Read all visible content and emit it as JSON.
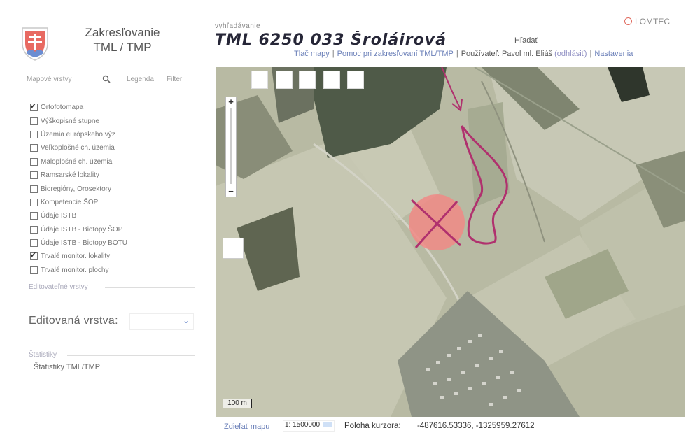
{
  "header": {
    "title_line1": "Zakresľovanie",
    "title_line2": "TML / TMP",
    "brand": "LOMTEC",
    "search_label": "vyhľadávanie",
    "search_value": "TML 6250 033 Šroláirová",
    "search_button": "Hľadať"
  },
  "toplinks": {
    "print": "Tlač mapy",
    "help": "Pomoc pri zakresľovaní TML/TMP",
    "user_label": "Používateľ: Pavol ml. Eliáš",
    "logout": "(odhlásiť)",
    "settings": "Nastavenia"
  },
  "sidebar": {
    "tabs": {
      "layers": "Mapové vrstvy",
      "legend": "Legenda",
      "filter": "Filter"
    },
    "layers": [
      {
        "label": "Ortofotomapa",
        "checked": true
      },
      {
        "label": "Výškopisné stupne",
        "checked": false
      },
      {
        "label": "Územia európskeho výz",
        "checked": false
      },
      {
        "label": "Veľkoplošné ch. územia",
        "checked": false
      },
      {
        "label": "Maloplošné ch. územia",
        "checked": false
      },
      {
        "label": "Ramsarské lokality",
        "checked": false
      },
      {
        "label": "Bioregióny, Orosektory",
        "checked": false
      },
      {
        "label": "Kompetencie ŠOP",
        "checked": false
      },
      {
        "label": "Údaje ISTB",
        "checked": false
      },
      {
        "label": "Údaje ISTB - Biotopy ŠOP",
        "checked": false
      },
      {
        "label": "Údaje ISTB - Biotopy BOTU",
        "checked": false
      },
      {
        "label": "Trvalé monitor. lokality",
        "checked": true
      },
      {
        "label": "Trvalé monitor. plochy",
        "checked": false
      }
    ],
    "editable_section": "Editovateľné vrstvy",
    "edited_layer_label": "Editovaná vrstva:",
    "stats_section": "Štatistiky",
    "stats_link": "Štatistiky TML/TMP"
  },
  "map": {
    "scale_bar": "100 m"
  },
  "footer": {
    "share": "Zdieľať mapu",
    "scale": "1: 1500000",
    "cursor_label": "Poloha kurzora:",
    "cursor_value": "-487616.53336, -1325959.27612"
  },
  "colors": {
    "link": "#6a7fb8",
    "highlight_polygon": "#b0316e",
    "marker_fill": "#f08a86",
    "brand_ring": "#e06a5e"
  },
  "icons": [
    "slovak-coat-of-arms-logo",
    "search-icon",
    "lomtec-ring-icon",
    "zoom-plus-icon",
    "zoom-minus-icon"
  ]
}
